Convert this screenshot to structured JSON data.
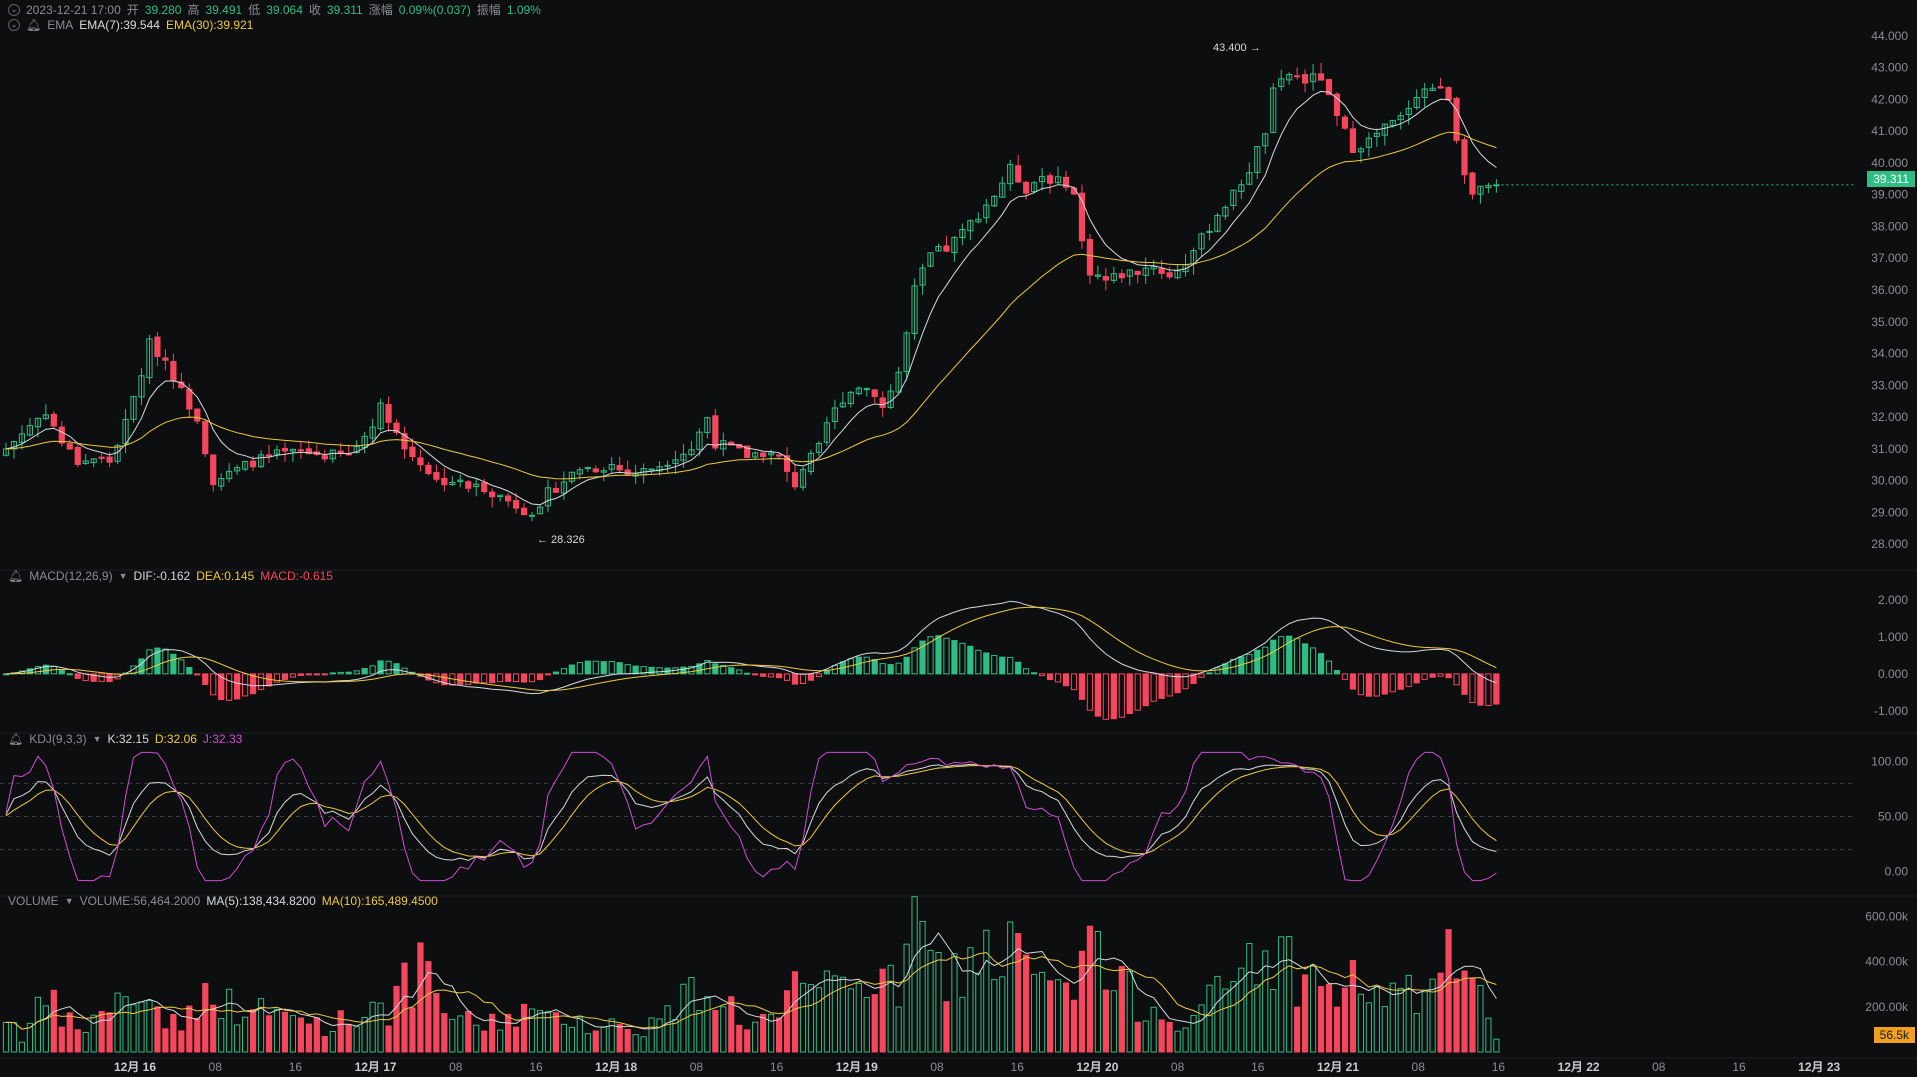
{
  "header": {
    "datetime": "2023-12-21 17:00",
    "open_label": "开",
    "open": "39.280",
    "high_label": "高",
    "high": "39.491",
    "low_label": "低",
    "low": "39.064",
    "close_label": "收",
    "close": "39.311",
    "change_label": "涨幅",
    "change": "0.09%(0.037)",
    "amp_label": "振幅",
    "amp": "1.09%"
  },
  "ema_legend": {
    "name": "EMA",
    "ema7": "EMA(7):39.544",
    "ema30": "EMA(30):39.921"
  },
  "macd_legend": {
    "name": "MACD(12,26,9)",
    "dif": "DIF:-0.162",
    "dea": "DEA:0.145",
    "macd": "MACD:-0.615"
  },
  "kdj_legend": {
    "name": "KDJ(9,3,3)",
    "k": "K:32.15",
    "d": "D:32.06",
    "j": "J:32.33"
  },
  "volume_legend": {
    "name": "VOLUME",
    "volume": "VOLUME:56,464.2000",
    "ma5": "MA(5):138,434.8200",
    "ma10": "MA(10):165,489.4500"
  },
  "last_price": "39.311",
  "last_volume": "56.5k",
  "annotations": {
    "high": "43.400",
    "low": "28.326"
  },
  "colors": {
    "up": "#2ebd85",
    "down": "#f6465d",
    "ema7": "#d7d9dc",
    "ema30": "#f0c93a",
    "j": "#d04bd6",
    "background": "#0d0e10"
  },
  "chart_data": {
    "type": "candlestick",
    "price_axis": {
      "ylim": [
        27.5,
        44.5
      ],
      "ticks": [
        "28.000",
        "29.000",
        "30.000",
        "31.000",
        "32.000",
        "33.000",
        "34.000",
        "35.000",
        "36.000",
        "37.000",
        "38.000",
        "39.000",
        "40.000",
        "41.000",
        "42.000",
        "43.000",
        "44.000"
      ]
    },
    "macd_axis": {
      "ylim": [
        -1.3,
        2.4
      ],
      "ticks": [
        "-1.000",
        "0.000",
        "1.000",
        "2.000"
      ]
    },
    "kdj_axis": {
      "ylim": [
        -12,
        112
      ],
      "ticks": [
        "0.00",
        "50.00",
        "100.00"
      ],
      "guides": [
        20,
        50,
        80
      ]
    },
    "volume_axis": {
      "ylim": [
        0,
        650
      ],
      "unit": "k",
      "ticks": [
        "200.00k",
        "400.00k",
        "600.00k"
      ]
    },
    "time_axis": {
      "labels": [
        "12月 16",
        "08",
        "16",
        "12月 17",
        "08",
        "16",
        "12月 18",
        "08",
        "16",
        "12月 19",
        "08",
        "16",
        "12月 20",
        "08",
        "16",
        "12月 21",
        "08",
        "16",
        "12月 22",
        "08",
        "16",
        "12月 23"
      ],
      "bold": [
        "12月 16",
        "12月 17",
        "12月 18",
        "12月 19",
        "12月 20",
        "12月 21",
        "12月 22",
        "12月 23"
      ]
    },
    "candle_bars_total": 188,
    "keypoints": [
      [
        0,
        31.0,
        170
      ],
      [
        2,
        31.5,
        70
      ],
      [
        5,
        32.2,
        220
      ],
      [
        7,
        31.2,
        160
      ],
      [
        9,
        30.6,
        90
      ],
      [
        11,
        30.7,
        140
      ],
      [
        13,
        30.6,
        220
      ],
      [
        15,
        31.8,
        200
      ],
      [
        17,
        33.4,
        280
      ],
      [
        18,
        34.3,
        240
      ],
      [
        20,
        33.8,
        130
      ],
      [
        22,
        32.8,
        160
      ],
      [
        24,
        32.0,
        150
      ],
      [
        26,
        30.0,
        330
      ],
      [
        28,
        30.2,
        200
      ],
      [
        31,
        30.6,
        180
      ],
      [
        34,
        30.8,
        160
      ],
      [
        37,
        30.9,
        150
      ],
      [
        40,
        30.8,
        120
      ],
      [
        43,
        30.8,
        140
      ],
      [
        45,
        31.4,
        180
      ],
      [
        47,
        32.3,
        240
      ],
      [
        48,
        32.0,
        200
      ],
      [
        50,
        31.0,
        280
      ],
      [
        52,
        30.6,
        340
      ],
      [
        54,
        30.0,
        240
      ],
      [
        56,
        30.0,
        160
      ],
      [
        58,
        29.8,
        130
      ],
      [
        60,
        29.8,
        120
      ],
      [
        62,
        29.5,
        140
      ],
      [
        65,
        29.1,
        190
      ],
      [
        67,
        29.0,
        140
      ],
      [
        68,
        29.6,
        130
      ],
      [
        70,
        30.0,
        180
      ],
      [
        72,
        30.4,
        150
      ],
      [
        74,
        30.4,
        110
      ],
      [
        76,
        30.5,
        120
      ],
      [
        78,
        30.2,
        100
      ],
      [
        80,
        30.3,
        110
      ],
      [
        82,
        30.5,
        140
      ],
      [
        84,
        30.8,
        190
      ],
      [
        86,
        31.0,
        260
      ],
      [
        88,
        32.0,
        320
      ],
      [
        89,
        31.2,
        240
      ],
      [
        91,
        31.0,
        200
      ],
      [
        93,
        30.8,
        130
      ],
      [
        95,
        30.9,
        140
      ],
      [
        97,
        30.7,
        150
      ],
      [
        98,
        30.2,
        200
      ],
      [
        99,
        29.9,
        280
      ],
      [
        100,
        30.4,
        220
      ],
      [
        102,
        31.0,
        240
      ],
      [
        103,
        31.8,
        280
      ],
      [
        105,
        32.6,
        340
      ],
      [
        107,
        33.0,
        380
      ],
      [
        109,
        32.8,
        300
      ],
      [
        110,
        32.3,
        260
      ],
      [
        112,
        33.4,
        300
      ],
      [
        113,
        34.6,
        400
      ],
      [
        114,
        36.0,
        560
      ],
      [
        116,
        37.1,
        400
      ],
      [
        118,
        37.3,
        300
      ],
      [
        120,
        37.8,
        380
      ],
      [
        122,
        38.4,
        420
      ],
      [
        124,
        39.0,
        450
      ],
      [
        126,
        39.8,
        430
      ],
      [
        128,
        39.2,
        380
      ],
      [
        130,
        39.6,
        300
      ],
      [
        132,
        39.4,
        260
      ],
      [
        133,
        39.4,
        230
      ],
      [
        134,
        39.0,
        280
      ],
      [
        135,
        37.5,
        380
      ],
      [
        136,
        36.6,
        600
      ],
      [
        138,
        36.3,
        300
      ],
      [
        140,
        36.5,
        270
      ],
      [
        142,
        36.6,
        230
      ],
      [
        144,
        36.8,
        200
      ],
      [
        146,
        36.4,
        170
      ],
      [
        148,
        36.9,
        150
      ],
      [
        150,
        37.6,
        180
      ],
      [
        152,
        38.4,
        250
      ],
      [
        154,
        39.0,
        300
      ],
      [
        156,
        39.8,
        430
      ],
      [
        158,
        41.0,
        450
      ],
      [
        159,
        42.2,
        430
      ],
      [
        161,
        42.8,
        380
      ],
      [
        163,
        42.6,
        320
      ],
      [
        165,
        42.7,
        300
      ],
      [
        166,
        42.0,
        280
      ],
      [
        167,
        41.4,
        260
      ],
      [
        169,
        40.5,
        300
      ],
      [
        171,
        40.7,
        280
      ],
      [
        173,
        41.1,
        260
      ],
      [
        175,
        41.4,
        230
      ],
      [
        177,
        42.2,
        250
      ],
      [
        179,
        42.4,
        300
      ],
      [
        181,
        42.1,
        420
      ],
      [
        182,
        40.8,
        440
      ],
      [
        183,
        39.8,
        280
      ],
      [
        184,
        39.0,
        240
      ],
      [
        186,
        39.2,
        190
      ],
      [
        187,
        39.5,
        130
      ],
      [
        188,
        39.9,
        170
      ],
      [
        190,
        39.3,
        60
      ]
    ]
  }
}
